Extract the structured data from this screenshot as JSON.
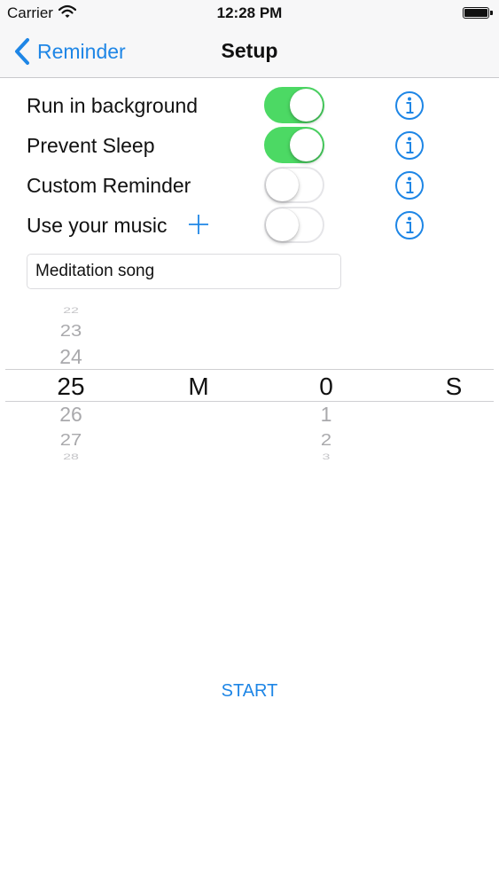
{
  "status_bar": {
    "carrier": "Carrier",
    "time": "12:28 PM"
  },
  "nav": {
    "back_label": "Reminder",
    "title": "Setup"
  },
  "settings": [
    {
      "label": "Run in background",
      "enabled": true
    },
    {
      "label": "Prevent Sleep",
      "enabled": true
    },
    {
      "label": "Custom Reminder",
      "enabled": false
    },
    {
      "label": "Use your music",
      "enabled": false
    }
  ],
  "song_field": {
    "value": "Meditation song"
  },
  "picker": {
    "minutes": {
      "above": [
        "22",
        "23",
        "24"
      ],
      "selected": "25",
      "below": [
        "26",
        "27",
        "28"
      ]
    },
    "minutes_unit": "M",
    "seconds": {
      "selected": "0",
      "below": [
        "1",
        "2",
        "3"
      ]
    },
    "seconds_unit": "S"
  },
  "start_label": "START",
  "colors": {
    "accent": "#1e86e6",
    "toggle_on": "#4cd964"
  }
}
